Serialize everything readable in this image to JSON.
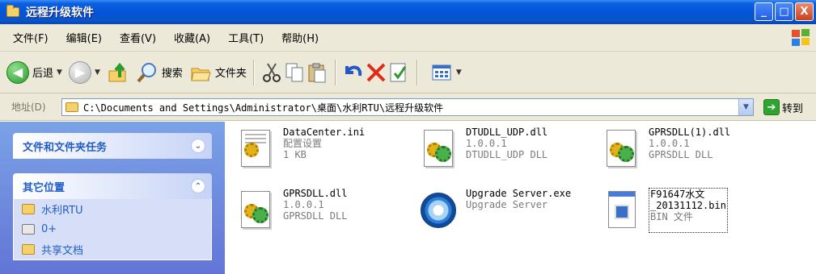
{
  "window": {
    "title": "远程升级软件",
    "buttons": {
      "minimize": "_",
      "maximize": "□",
      "close": "X"
    }
  },
  "menu": [
    "文件(F)",
    "编辑(E)",
    "查看(V)",
    "收藏(A)",
    "工具(T)",
    "帮助(H)"
  ],
  "toolbar": {
    "back_label": "后退",
    "search_label": "搜索",
    "folders_label": "文件夹"
  },
  "address": {
    "label": "地址(D)",
    "path": "C:\\Documents and Settings\\Administrator\\桌面\\水利RTU\\远程升级软件",
    "go_label": "转到"
  },
  "left_pane": {
    "tasks_title": "文件和文件夹任务",
    "other_title": "其它位置",
    "other_items": [
      "水利RTU",
      "0+",
      "共享文档"
    ]
  },
  "files": [
    {
      "name": "DataCenter.ini",
      "line2": "配置设置",
      "line3": "1 KB",
      "icon": "config-settings-icon"
    },
    {
      "name": "DTUDLL_UDP.dll",
      "line2": "1.0.0.1",
      "line3": "DTUDLL_UDP DLL",
      "icon": "dll-icon"
    },
    {
      "name": "GPRSDLL(1).dll",
      "line2": "1.0.0.1",
      "line3": "GPRSDLL DLL",
      "icon": "dll-icon"
    },
    {
      "name": "GPRSDLL.dll",
      "line2": "1.0.0.1",
      "line3": "GPRSDLL DLL",
      "icon": "dll-icon"
    },
    {
      "name": "Upgrade Server.exe",
      "line2": "Upgrade Server",
      "line3": "",
      "icon": "globe-exe-icon"
    },
    {
      "name": "F91647水文",
      "name2": "_20131112.bin",
      "line2": "BIN 文件",
      "line3": "",
      "icon": "bin-file-icon"
    }
  ]
}
